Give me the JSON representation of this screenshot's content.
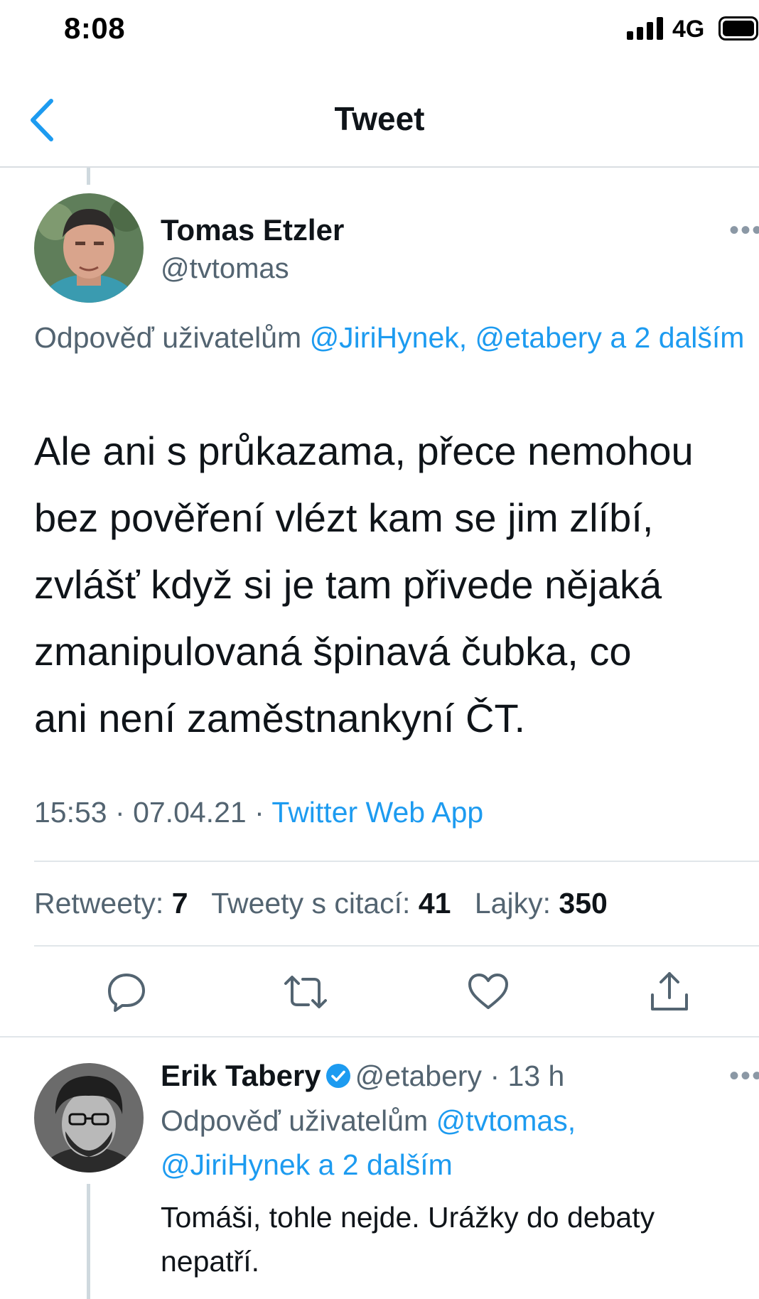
{
  "status_bar": {
    "time": "8:08",
    "network": "4G"
  },
  "nav": {
    "title": "Tweet"
  },
  "tweet": {
    "author_name": "Tomas Etzler",
    "author_handle": "@tvtomas",
    "replying_prefix": "Odpověď uživatelům ",
    "replying_targets": "@JiriHynek, @etabery a 2 dalším",
    "text": "Ale ani s průkazama, přece nemohou\nbez pověření vlézt kam se jim zlíbí,\nzvlášť když si je tam přivede nějaká\nzmanipulovaná špinavá čubka, co\nani není zaměstnankyní ČT.",
    "time": "15:53",
    "date": "07.04.21",
    "separator": "·",
    "source": "Twitter Web App",
    "stats": {
      "retweets_label": "Retweety:",
      "retweets": "7",
      "quotes_label": "Tweety s citací:",
      "quotes": "41",
      "likes_label": "Lajky:",
      "likes": "350"
    },
    "actions": [
      "reply-icon",
      "retweet-icon",
      "like-icon",
      "share-icon"
    ]
  },
  "reply": {
    "author_name": "Erik Tabery",
    "verified": true,
    "author_handle": "@etabery",
    "separator": "·",
    "age": "13 h",
    "replying_prefix": "Odpověď uživatelům ",
    "replying_targets_1": "@tvtomas,",
    "replying_targets_2": "@JiriHynek a 2 dalším",
    "text": "Tomáši, tohle nejde. Urážky do debaty nepatří."
  },
  "colors": {
    "accent": "#1d9bf0",
    "secondary_text": "#536471",
    "primary_text": "#0f1419",
    "divider": "#e1e6ea"
  }
}
